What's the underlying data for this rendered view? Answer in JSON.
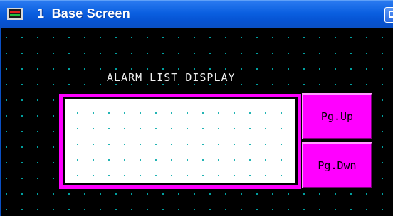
{
  "window": {
    "title": "1  Base Screen"
  },
  "screen": {
    "alarm_heading": "ALARM LIST DISPLAY",
    "buttons": {
      "page_up": "Pg.Up",
      "page_down": "Pg.Dwn"
    }
  },
  "colors": {
    "titlebar": "#0a5fe0",
    "background": "#000000",
    "grid_dot": "#00b8b8",
    "alarm_frame": "#ff00ff",
    "alarm_list_bg": "#ffffff",
    "button_bg": "#ff00ff"
  },
  "icons": {
    "app": "screen-icon",
    "title_button": "restore-icon"
  }
}
